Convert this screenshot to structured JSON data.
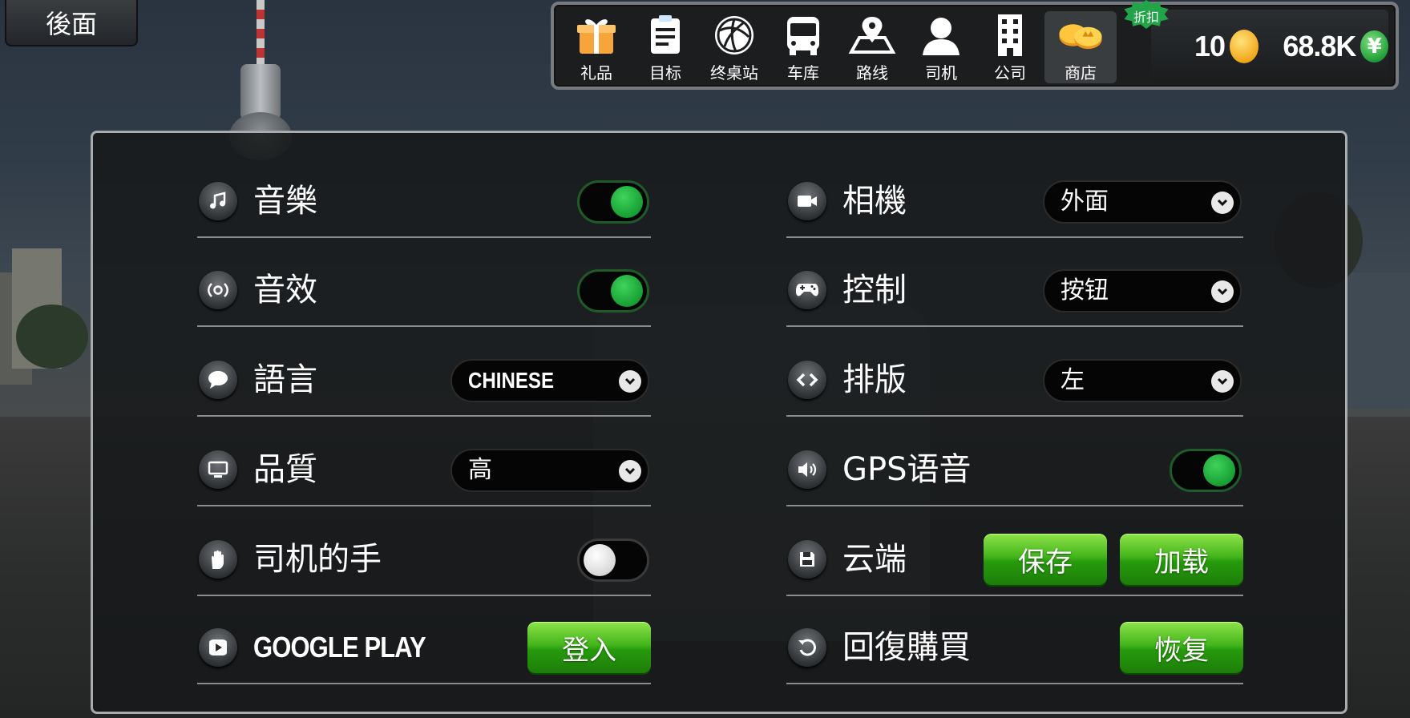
{
  "back_button": {
    "label": "後面"
  },
  "top_nav": {
    "items": [
      {
        "label": "礼品",
        "icon": "gift-icon"
      },
      {
        "label": "目标",
        "icon": "clipboard-icon"
      },
      {
        "label": "终桌站",
        "icon": "globe-icon"
      },
      {
        "label": "车库",
        "icon": "bus-icon"
      },
      {
        "label": "路线",
        "icon": "map-pin-icon"
      },
      {
        "label": "司机",
        "icon": "driver-icon"
      },
      {
        "label": "公司",
        "icon": "building-icon"
      },
      {
        "label": "商店",
        "icon": "coins-icon"
      }
    ],
    "discount_badge": "折扣",
    "coins": "10",
    "money": "68.8K",
    "money_symbol": "¥"
  },
  "settings": {
    "left": [
      {
        "label": "音樂",
        "type": "toggle",
        "on": true,
        "icon": "music-note-icon"
      },
      {
        "label": "音效",
        "type": "toggle",
        "on": true,
        "icon": "sound-effect-icon"
      },
      {
        "label": "語言",
        "type": "dropdown",
        "value": "CHINESE",
        "icon": "speech-bubble-icon"
      },
      {
        "label": "品質",
        "type": "dropdown",
        "value": "高",
        "icon": "monitor-icon"
      },
      {
        "label": "司机的手",
        "type": "toggle",
        "on": false,
        "icon": "hand-icon"
      },
      {
        "label": "GOOGLE PLAY",
        "type": "button",
        "button_label": "登入",
        "icon": "gamepad-play-icon"
      }
    ],
    "right": [
      {
        "label": "相機",
        "type": "dropdown",
        "value": "外面",
        "icon": "camera-icon"
      },
      {
        "label": "控制",
        "type": "dropdown",
        "value": "按钮",
        "icon": "gamepad-icon"
      },
      {
        "label": "排版",
        "type": "dropdown",
        "value": "左",
        "icon": "code-arrows-icon"
      },
      {
        "label": "GPS语音",
        "type": "toggle",
        "on": true,
        "icon": "speaker-icon"
      },
      {
        "label": "云端",
        "type": "buttons",
        "buttons": [
          "保存",
          "加载"
        ],
        "icon": "floppy-disk-icon"
      },
      {
        "label": "回復購買",
        "type": "button",
        "button_label": "恢复",
        "icon": "restore-icon"
      }
    ]
  },
  "colors": {
    "toggle_on": "#17a034",
    "button_green": "#43b51b",
    "panel_border": "#a9acaf"
  }
}
